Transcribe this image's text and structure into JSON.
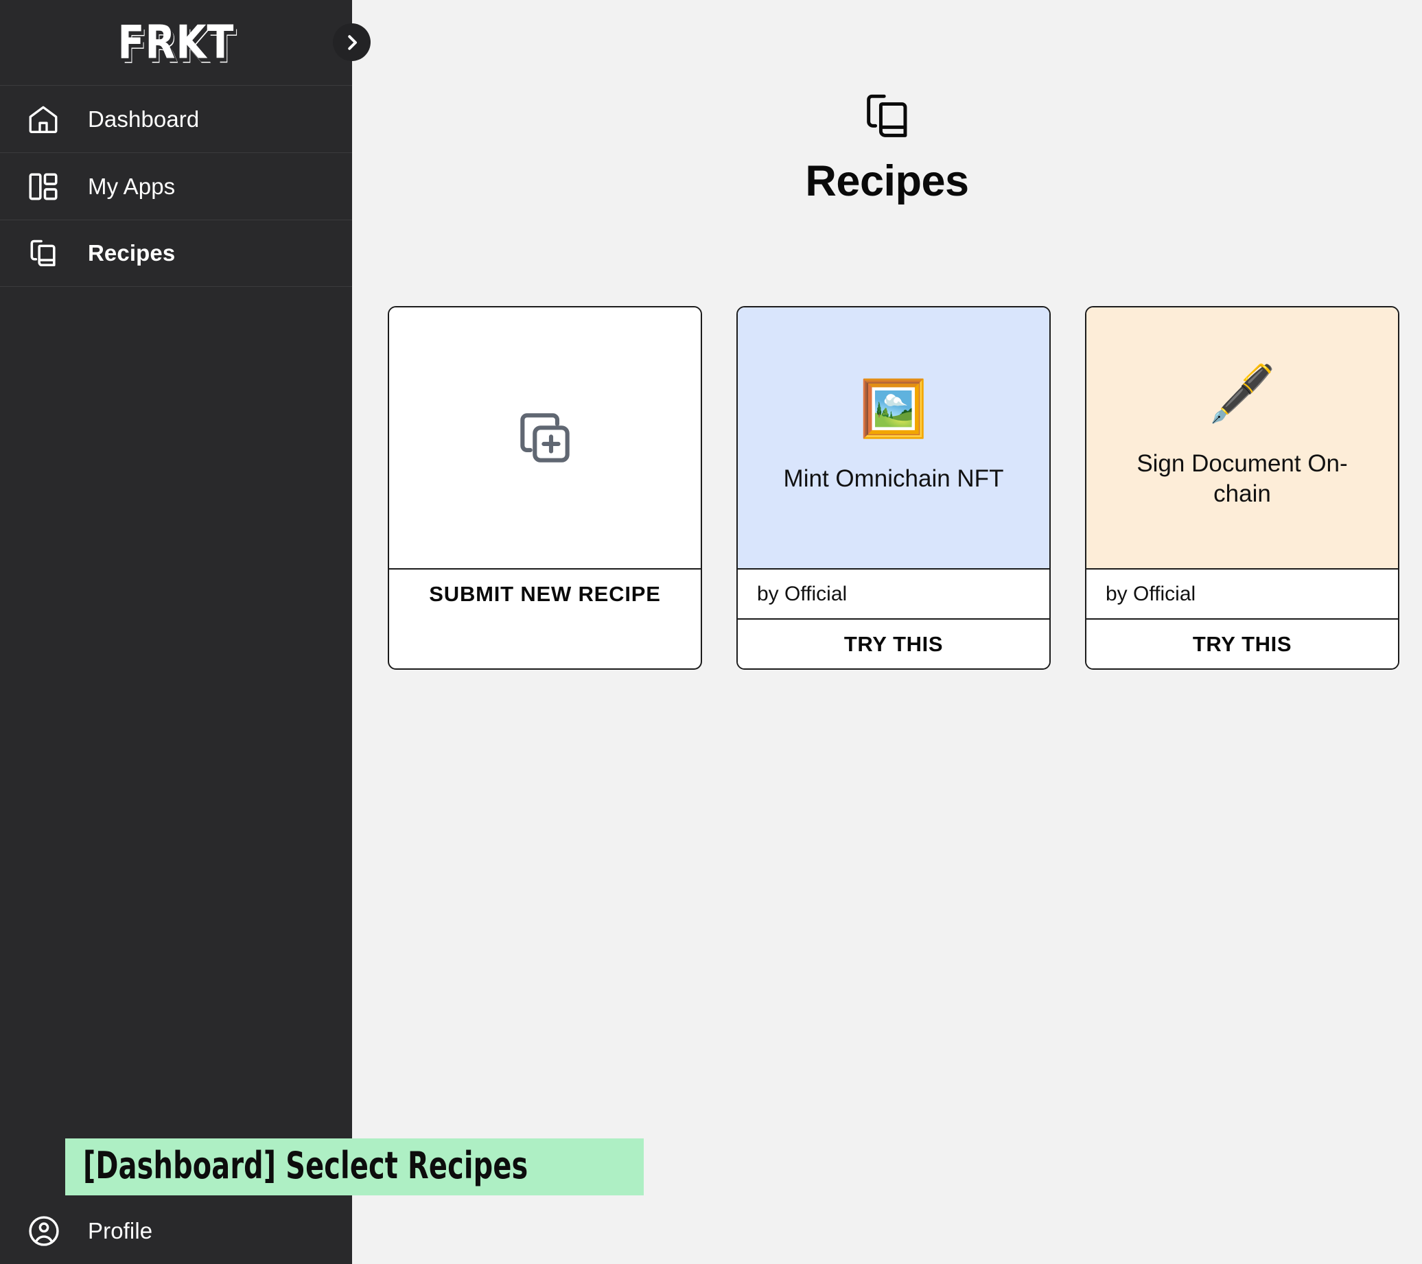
{
  "sidebar": {
    "brand": "FRKT",
    "collapse_toggle_icon": "chevron-right-icon",
    "items": [
      {
        "label": "Dashboard",
        "icon": "home-icon",
        "active": false
      },
      {
        "label": "My Apps",
        "icon": "layout-dashboard-icon",
        "active": false
      },
      {
        "label": "Recipes",
        "icon": "books-icon",
        "active": true
      }
    ],
    "profile": {
      "label": "Profile",
      "icon": "user-circle-icon"
    }
  },
  "main": {
    "header": {
      "icon": "books-icon",
      "title": "Recipes"
    },
    "cards": [
      {
        "kind": "submit",
        "icon": "copy-plus-icon",
        "name": "",
        "author": "",
        "action_label": "SUBMIT NEW RECIPE",
        "bg": "#ffffff"
      },
      {
        "kind": "recipe",
        "emoji": "🖼️",
        "emoji_name": "framed-picture-emoji",
        "name": "Mint Omnichain NFT",
        "author": "by Official",
        "action_label": "TRY THIS",
        "bg": "#d9e5fc"
      },
      {
        "kind": "recipe",
        "emoji": "🖋️",
        "emoji_name": "fountain-pen-emoji",
        "name": "Sign Document On-chain",
        "author": "by Official",
        "action_label": "TRY THIS",
        "bg": "#fdedd8"
      }
    ]
  },
  "annotation": {
    "text": "[Dashboard] Seclect Recipes",
    "bg": "#aeefc4"
  },
  "colors": {
    "sidebar_bg": "#29292b",
    "main_bg": "#f2f2f2",
    "card_border": "#1b1b1b",
    "card_blue": "#d9e5fc",
    "card_peach": "#fdedd8",
    "annotation_green": "#aeefc4"
  }
}
